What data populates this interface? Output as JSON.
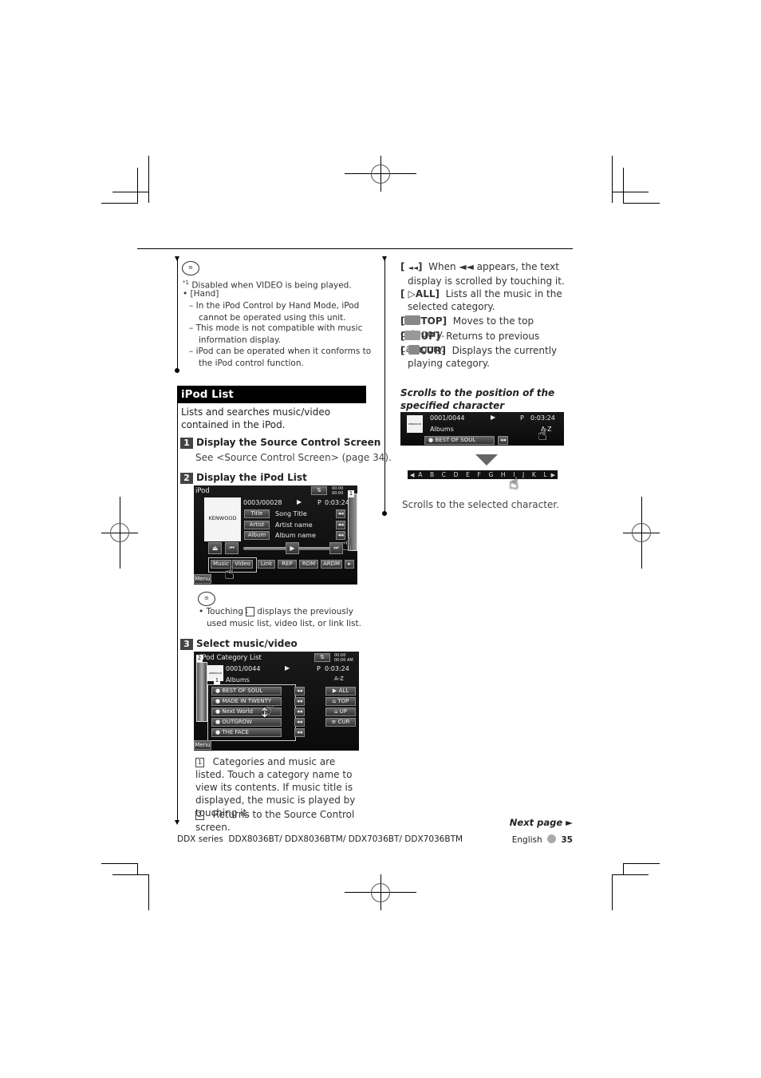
{
  "notes_top": {
    "footnote_mark": "*1",
    "footnote": "Disabled when VIDEO is being played.",
    "bullet": "[Hand]",
    "items": [
      "In the iPod Control by Hand Mode, iPod cannot be operated using this unit.",
      "This mode is not compatible with music information display.",
      "iPod can be operated when it conforms to the iPod control function."
    ]
  },
  "section": {
    "title": "iPod List",
    "intro": "Lists and searches music/video contained in the iPod."
  },
  "steps": [
    {
      "num": "1",
      "title": "Display the Source Control Screen",
      "text": "See <Source Control Screen> (page 34)."
    },
    {
      "num": "2",
      "title": "Display the iPod List"
    },
    {
      "num": "3",
      "title": "Select music/video"
    }
  ],
  "screen1": {
    "source": "iPod",
    "track_counter": "0003/00028",
    "play_mode": "P",
    "time": "0:03:24",
    "clock": "00:00 00:00",
    "logo": "KENWOOD",
    "rows": [
      {
        "label": "Title",
        "value": "Song Title"
      },
      {
        "label": "Artist",
        "value": "Artist name"
      },
      {
        "label": "Album",
        "value": "Album name"
      }
    ],
    "buttons": [
      "Music",
      "Video",
      "Link",
      "REP",
      "RDM",
      "ARDM"
    ],
    "menu": "Menu",
    "callout": "1"
  },
  "note_mid": {
    "text_before": "Touching",
    "box": "1",
    "text_after": "displays the previously used music list, video list, or link list."
  },
  "screen2": {
    "title": "iPod Category List",
    "track_counter": "0001/0044",
    "play_mode": "P",
    "time": "0:03:24",
    "clock": "00:00 00:00 AM",
    "category": "Albums",
    "az": "A-Z",
    "items": [
      "BEST OF SOUL",
      "MADE IN TWENTY",
      "Next World",
      "OUTGROW",
      "THE FACE"
    ],
    "side_buttons": [
      "ALL",
      "TOP",
      "UP",
      "CUR"
    ],
    "menu": "Menu",
    "callouts": [
      "1",
      "2"
    ]
  },
  "legend": [
    {
      "num": "1",
      "text": "Categories and music are listed. Touch a category name to view its contents. If music title is displayed, the music is played by touching it."
    },
    {
      "num": "2",
      "text": "Returns to the Source Control screen."
    }
  ],
  "right_col": {
    "items": [
      {
        "key": "◄◄",
        "text": "When ◄◄ appears, the text display is scrolled by touching it."
      },
      {
        "key": "ALL",
        "text": "Lists all the music in the selected category."
      },
      {
        "key": "TOP",
        "text": "Moves to the top category."
      },
      {
        "key": "UP",
        "text": "Returns to previous category."
      },
      {
        "key": "CUR",
        "text": "Displays the currently playing category."
      }
    ],
    "subheading": "Scrolls to the position of the specified character",
    "screen3": {
      "track_counter": "0001/0044",
      "play_mode": "P",
      "time": "0:03:24",
      "category": "Albums",
      "az": "A-Z",
      "item": "BEST OF SOUL"
    },
    "alphabet": [
      "A",
      "B",
      "C",
      "D",
      "E",
      "F",
      "G",
      "H",
      "I",
      "J",
      "K",
      "L"
    ],
    "caption": "Scrolls to the selected character."
  },
  "next_page": "Next page ►",
  "footer": {
    "series": "DDX series",
    "models": "DDX8036BT/ DDX8036BTM/ DDX7036BT/ DDX7036BTM",
    "language": "English",
    "page": "35"
  }
}
